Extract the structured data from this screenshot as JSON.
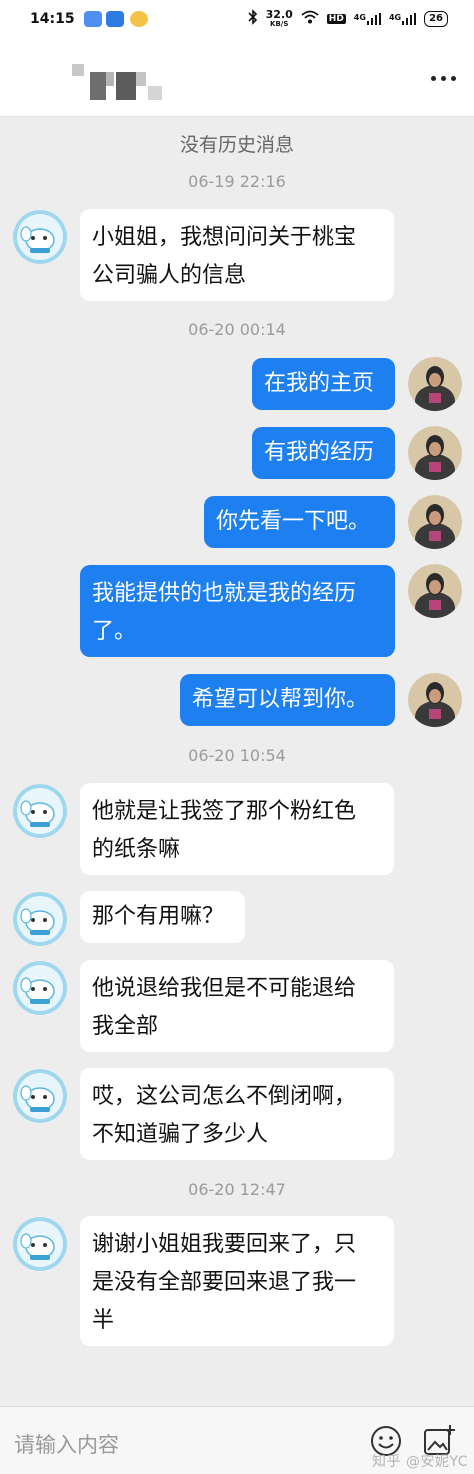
{
  "status_bar": {
    "time": "14:15",
    "net_speed_value": "32.0",
    "net_speed_unit": "KB/S",
    "hd_label": "HD",
    "sim1": "4G",
    "sim2": "4G",
    "battery": "26"
  },
  "header": {
    "title_pixelated": true,
    "more_icon": "more-dots-icon"
  },
  "chat": {
    "no_history": "没有历史消息",
    "timestamps": [
      "06-19 22:16",
      "06-20 00:14",
      "06-20 10:54",
      "06-20 12:47"
    ],
    "messages": [
      {
        "side": "left",
        "text": "小姐姐，我想问问关于桃宝\n公司骗人的信息"
      },
      {
        "side": "right",
        "text": "在我的主页"
      },
      {
        "side": "right",
        "text": "有我的经历"
      },
      {
        "side": "right",
        "text": "你先看一下吧。"
      },
      {
        "side": "right",
        "text": "我能提供的也就是我的经历\n了。"
      },
      {
        "side": "right",
        "text": "希望可以帮到你。"
      },
      {
        "side": "left",
        "text": "他就是让我签了那个粉红色\n的纸条嘛"
      },
      {
        "side": "left",
        "text": "那个有用嘛？"
      },
      {
        "side": "left",
        "text": "他说退给我但是不可能退给\n我全部"
      },
      {
        "side": "left",
        "text": "哎，这公司怎么不倒闭啊，\n不知道骗了多少人"
      },
      {
        "side": "left",
        "text": "谢谢小姐姐我要回来了，只\n是没有全部要回来退了我一\n半"
      }
    ]
  },
  "input_bar": {
    "placeholder": "请输入内容",
    "emoji_icon": "emoji-icon",
    "add_image_icon": "add-image-icon",
    "watermark": "知乎 @安妮YC"
  },
  "colors": {
    "accent_bubble": "#1e80f0",
    "background": "#ededed"
  }
}
